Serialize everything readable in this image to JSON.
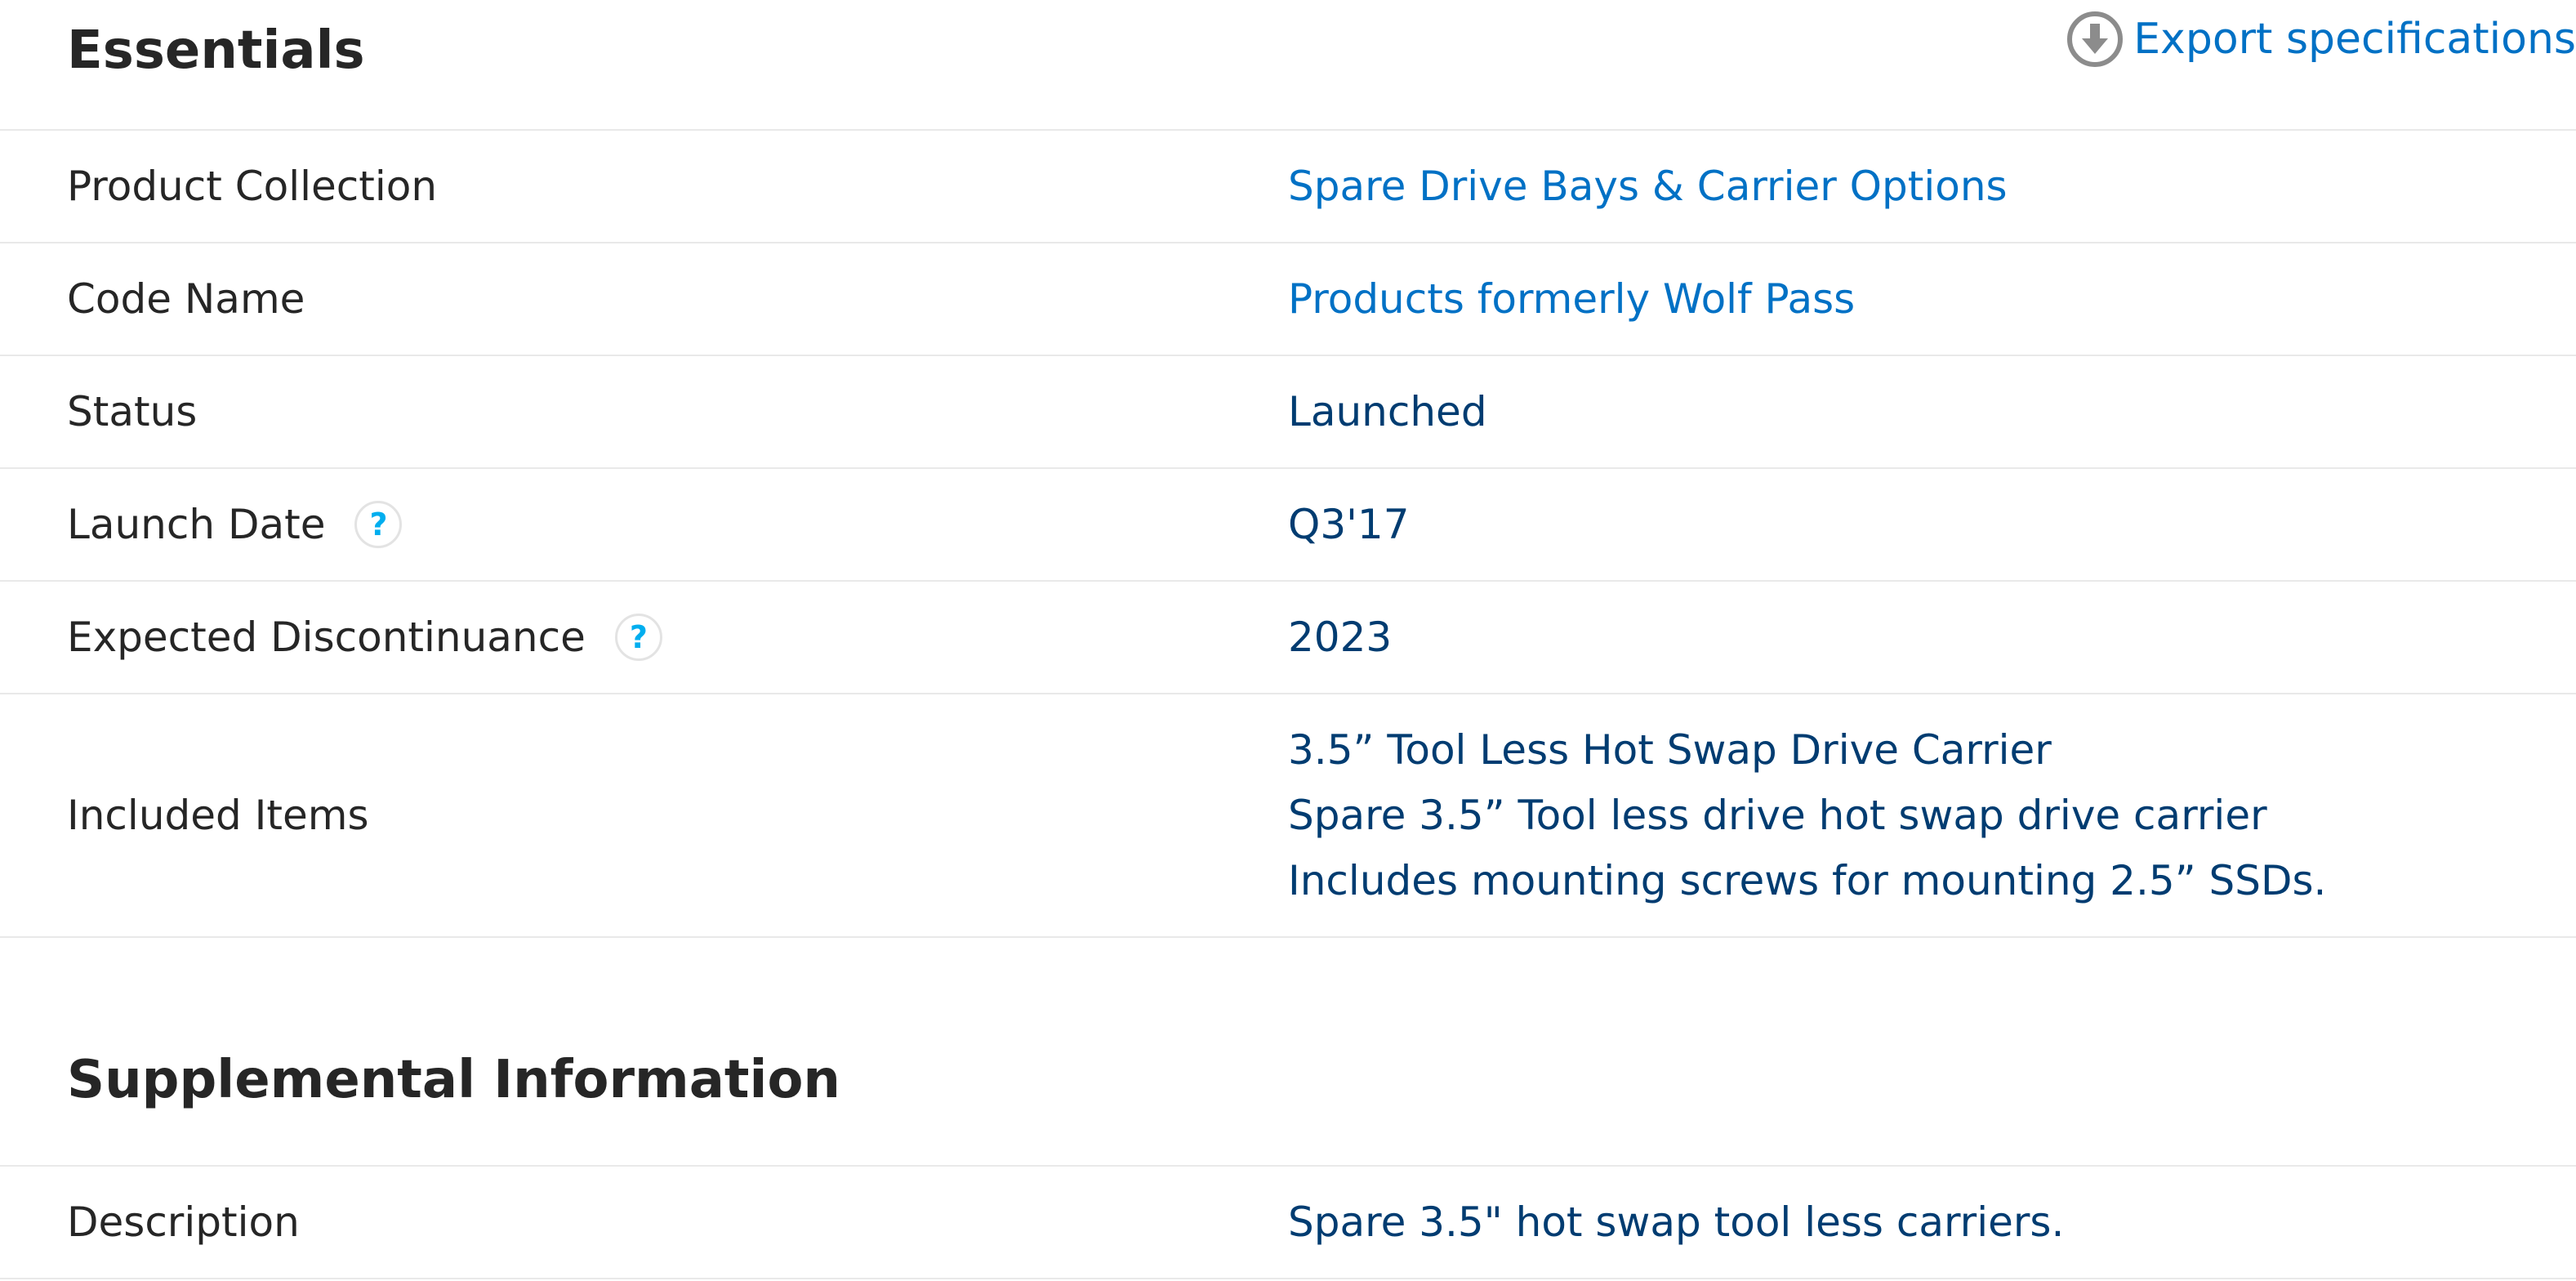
{
  "sections": {
    "essentials": {
      "title": "Essentials",
      "export_label": "Export specifications",
      "export_icon": "download-circle-icon",
      "rows": {
        "product_collection": {
          "label": "Product Collection",
          "value": "Spare Drive Bays & Carrier Options"
        },
        "code_name": {
          "label": "Code Name",
          "value": "Products formerly Wolf Pass"
        },
        "status": {
          "label": "Status",
          "value": "Launched"
        },
        "launch_date": {
          "label": "Launch Date",
          "value": "Q3'17",
          "help": "?"
        },
        "expected_discontinuance": {
          "label": "Expected Discontinuance",
          "value": "2023",
          "help": "?"
        },
        "included_items": {
          "label": "Included Items",
          "lines": [
            "3.5” Tool Less Hot Swap Drive Carrier",
            "Spare 3.5” Tool less drive hot swap drive carrier",
            "Includes mounting screws for mounting 2.5” SSDs."
          ]
        }
      }
    },
    "supplemental": {
      "title": "Supplemental Information",
      "rows": {
        "description": {
          "label": "Description",
          "value": "Spare 3.5\" hot swap tool less carriers."
        }
      }
    }
  },
  "colors": {
    "link": "#0071c5",
    "value_text": "#003c71",
    "label_text": "#262626",
    "divider": "#e9e9e9",
    "help_icon": "#00aeef"
  }
}
